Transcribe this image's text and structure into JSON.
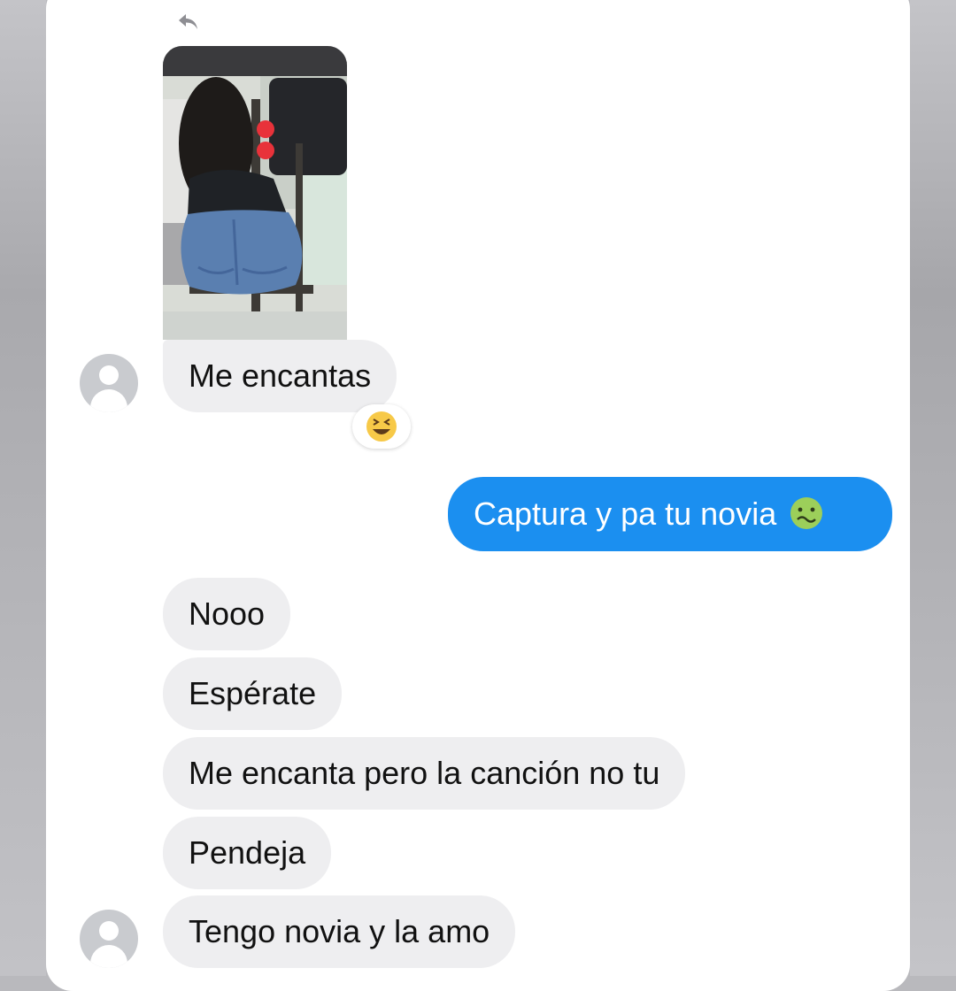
{
  "conversation": {
    "messages": [
      {
        "side": "received",
        "text": "Me encantas",
        "reaction_icon": "grinning-squinting-face-emoji"
      },
      {
        "side": "sent",
        "text": "Captura y pa tu novia",
        "emoji_icon": "nauseated-face-emoji"
      },
      {
        "side": "received",
        "text": "Nooo"
      },
      {
        "side": "received",
        "text": "Espérate"
      },
      {
        "side": "received",
        "text": "Me encanta pero la canción no tu"
      },
      {
        "side": "received",
        "text": "Pendeja"
      },
      {
        "side": "received",
        "text": "Tengo novia y la amo"
      }
    ]
  },
  "colors": {
    "sent_bubble": "#1b8ff0",
    "received_bubble": "#eeeef0",
    "background": "#ffffff"
  }
}
